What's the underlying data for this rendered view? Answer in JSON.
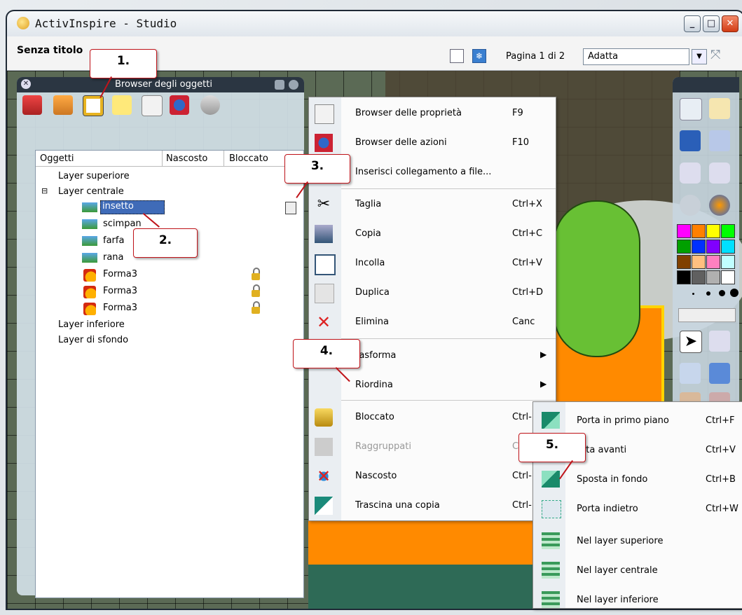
{
  "window": {
    "title": "ActivInspire - Studio"
  },
  "toolbar": {
    "doc_title": "Senza titolo",
    "page_info": "Pagina 1 di 2",
    "zoom_value": "Adatta"
  },
  "object_browser": {
    "title": "Browser degli oggetti",
    "columns": [
      "Oggetti",
      "Nascosto",
      "Bloccato"
    ],
    "rows": [
      {
        "label": "Layer superiore"
      },
      {
        "label": "Layer centrale"
      },
      {
        "label": "insetto"
      },
      {
        "label": "scimpan"
      },
      {
        "label": "farfa"
      },
      {
        "label": "rana"
      },
      {
        "label": "Forma3"
      },
      {
        "label": "Forma3"
      },
      {
        "label": "Forma3"
      },
      {
        "label": "Layer inferiore"
      },
      {
        "label": "Layer di sfondo"
      }
    ]
  },
  "context_menu": {
    "items": [
      {
        "label": "Browser delle proprietà",
        "shortcut": "F9"
      },
      {
        "label": "Browser delle azioni",
        "shortcut": "F10"
      },
      {
        "label": "Inserisci collegamento a file...",
        "shortcut": ""
      },
      {
        "label": "Taglia",
        "shortcut": "Ctrl+X"
      },
      {
        "label": "Copia",
        "shortcut": "Ctrl+C"
      },
      {
        "label": "Incolla",
        "shortcut": "Ctrl+V"
      },
      {
        "label": "Duplica",
        "shortcut": "Ctrl+D"
      },
      {
        "label": "Elimina",
        "shortcut": "Canc"
      },
      {
        "label": "rasforma",
        "shortcut": ""
      },
      {
        "label": "Riordina",
        "shortcut": ""
      },
      {
        "label": "Bloccato",
        "shortcut": "Ctrl-"
      },
      {
        "label": "Raggruppati",
        "shortcut": "C"
      },
      {
        "label": "Nascosto",
        "shortcut": "Ctrl-"
      },
      {
        "label": "Trascina una copia",
        "shortcut": "Ctrl-"
      }
    ]
  },
  "submenu": {
    "items": [
      {
        "label": "Porta in primo piano",
        "shortcut": "Ctrl+F"
      },
      {
        "label": "orta avanti",
        "shortcut": "Ctrl+V"
      },
      {
        "label": "Sposta in fondo",
        "shortcut": "Ctrl+B"
      },
      {
        "label": "Porta indietro",
        "shortcut": "Ctrl+W"
      },
      {
        "label": "Nel layer superiore",
        "shortcut": ""
      },
      {
        "label": "Nel layer centrale",
        "shortcut": ""
      },
      {
        "label": "Nel layer inferiore",
        "shortcut": ""
      }
    ]
  },
  "callouts": {
    "c1": "1.",
    "c2": "2.",
    "c3": "3.",
    "c4": "4.",
    "c5": "5."
  },
  "colors": {
    "accent": "#c0141a",
    "selection": "#3f6bb8",
    "canvas_orange": "#ff8a00"
  }
}
